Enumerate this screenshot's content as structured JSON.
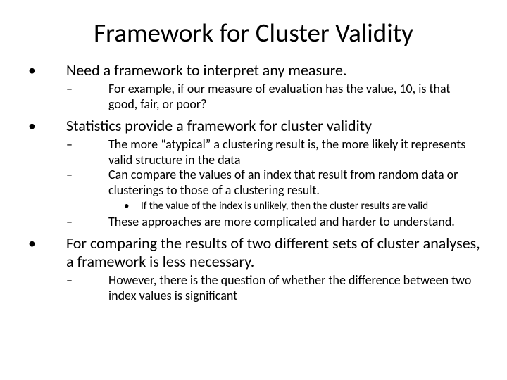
{
  "title": "Framework for Cluster Validity",
  "p1": "Need a framework to interpret any measure.",
  "p1a": "For example, if our measure of evaluation has the value, 10, is that good, fair, or poor?",
  "p2": "Statistics provide a framework for cluster validity",
  "p2a": "The more “atypical” a clustering result is, the more likely it represents valid structure in the data",
  "p2b": "Can compare the values of an index that result from random data or clusterings to those of a clustering result.",
  "p2b1": "If the value of the index is unlikely, then the cluster results are valid",
  "p2c": "These approaches are more complicated and harder to understand.",
  "p3": "For comparing the results of two different sets of cluster analyses, a framework is less necessary.",
  "p3a": "However, there is the question of whether the difference between two index values is significant"
}
